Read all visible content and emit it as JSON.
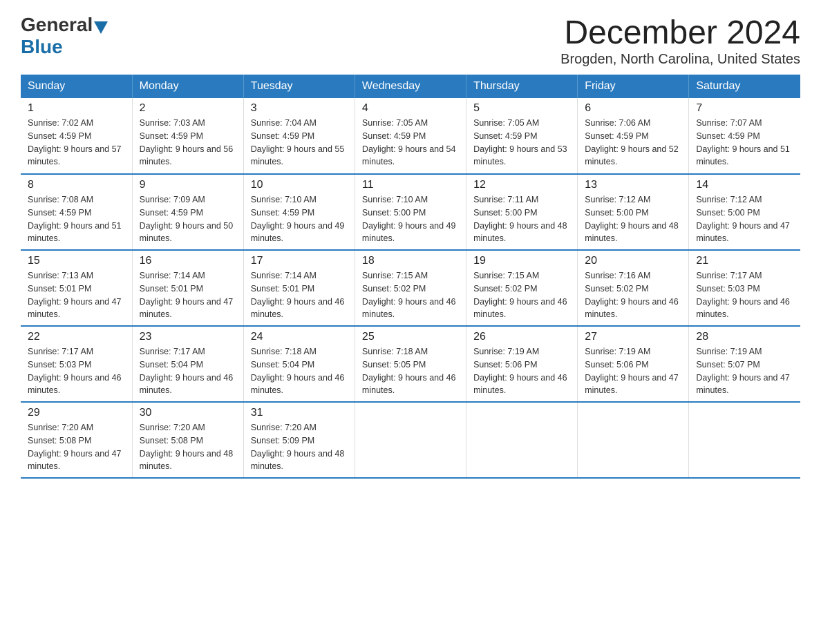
{
  "logo": {
    "general": "General",
    "blue": "Blue"
  },
  "header": {
    "title": "December 2024",
    "location": "Brogden, North Carolina, United States"
  },
  "weekdays": [
    "Sunday",
    "Monday",
    "Tuesday",
    "Wednesday",
    "Thursday",
    "Friday",
    "Saturday"
  ],
  "weeks": [
    [
      {
        "day": "1",
        "sunrise": "7:02 AM",
        "sunset": "4:59 PM",
        "daylight": "9 hours and 57 minutes."
      },
      {
        "day": "2",
        "sunrise": "7:03 AM",
        "sunset": "4:59 PM",
        "daylight": "9 hours and 56 minutes."
      },
      {
        "day": "3",
        "sunrise": "7:04 AM",
        "sunset": "4:59 PM",
        "daylight": "9 hours and 55 minutes."
      },
      {
        "day": "4",
        "sunrise": "7:05 AM",
        "sunset": "4:59 PM",
        "daylight": "9 hours and 54 minutes."
      },
      {
        "day": "5",
        "sunrise": "7:05 AM",
        "sunset": "4:59 PM",
        "daylight": "9 hours and 53 minutes."
      },
      {
        "day": "6",
        "sunrise": "7:06 AM",
        "sunset": "4:59 PM",
        "daylight": "9 hours and 52 minutes."
      },
      {
        "day": "7",
        "sunrise": "7:07 AM",
        "sunset": "4:59 PM",
        "daylight": "9 hours and 51 minutes."
      }
    ],
    [
      {
        "day": "8",
        "sunrise": "7:08 AM",
        "sunset": "4:59 PM",
        "daylight": "9 hours and 51 minutes."
      },
      {
        "day": "9",
        "sunrise": "7:09 AM",
        "sunset": "4:59 PM",
        "daylight": "9 hours and 50 minutes."
      },
      {
        "day": "10",
        "sunrise": "7:10 AM",
        "sunset": "4:59 PM",
        "daylight": "9 hours and 49 minutes."
      },
      {
        "day": "11",
        "sunrise": "7:10 AM",
        "sunset": "5:00 PM",
        "daylight": "9 hours and 49 minutes."
      },
      {
        "day": "12",
        "sunrise": "7:11 AM",
        "sunset": "5:00 PM",
        "daylight": "9 hours and 48 minutes."
      },
      {
        "day": "13",
        "sunrise": "7:12 AM",
        "sunset": "5:00 PM",
        "daylight": "9 hours and 48 minutes."
      },
      {
        "day": "14",
        "sunrise": "7:12 AM",
        "sunset": "5:00 PM",
        "daylight": "9 hours and 47 minutes."
      }
    ],
    [
      {
        "day": "15",
        "sunrise": "7:13 AM",
        "sunset": "5:01 PM",
        "daylight": "9 hours and 47 minutes."
      },
      {
        "day": "16",
        "sunrise": "7:14 AM",
        "sunset": "5:01 PM",
        "daylight": "9 hours and 47 minutes."
      },
      {
        "day": "17",
        "sunrise": "7:14 AM",
        "sunset": "5:01 PM",
        "daylight": "9 hours and 46 minutes."
      },
      {
        "day": "18",
        "sunrise": "7:15 AM",
        "sunset": "5:02 PM",
        "daylight": "9 hours and 46 minutes."
      },
      {
        "day": "19",
        "sunrise": "7:15 AM",
        "sunset": "5:02 PM",
        "daylight": "9 hours and 46 minutes."
      },
      {
        "day": "20",
        "sunrise": "7:16 AM",
        "sunset": "5:02 PM",
        "daylight": "9 hours and 46 minutes."
      },
      {
        "day": "21",
        "sunrise": "7:17 AM",
        "sunset": "5:03 PM",
        "daylight": "9 hours and 46 minutes."
      }
    ],
    [
      {
        "day": "22",
        "sunrise": "7:17 AM",
        "sunset": "5:03 PM",
        "daylight": "9 hours and 46 minutes."
      },
      {
        "day": "23",
        "sunrise": "7:17 AM",
        "sunset": "5:04 PM",
        "daylight": "9 hours and 46 minutes."
      },
      {
        "day": "24",
        "sunrise": "7:18 AM",
        "sunset": "5:04 PM",
        "daylight": "9 hours and 46 minutes."
      },
      {
        "day": "25",
        "sunrise": "7:18 AM",
        "sunset": "5:05 PM",
        "daylight": "9 hours and 46 minutes."
      },
      {
        "day": "26",
        "sunrise": "7:19 AM",
        "sunset": "5:06 PM",
        "daylight": "9 hours and 46 minutes."
      },
      {
        "day": "27",
        "sunrise": "7:19 AM",
        "sunset": "5:06 PM",
        "daylight": "9 hours and 47 minutes."
      },
      {
        "day": "28",
        "sunrise": "7:19 AM",
        "sunset": "5:07 PM",
        "daylight": "9 hours and 47 minutes."
      }
    ],
    [
      {
        "day": "29",
        "sunrise": "7:20 AM",
        "sunset": "5:08 PM",
        "daylight": "9 hours and 47 minutes."
      },
      {
        "day": "30",
        "sunrise": "7:20 AM",
        "sunset": "5:08 PM",
        "daylight": "9 hours and 48 minutes."
      },
      {
        "day": "31",
        "sunrise": "7:20 AM",
        "sunset": "5:09 PM",
        "daylight": "9 hours and 48 minutes."
      },
      null,
      null,
      null,
      null
    ]
  ]
}
